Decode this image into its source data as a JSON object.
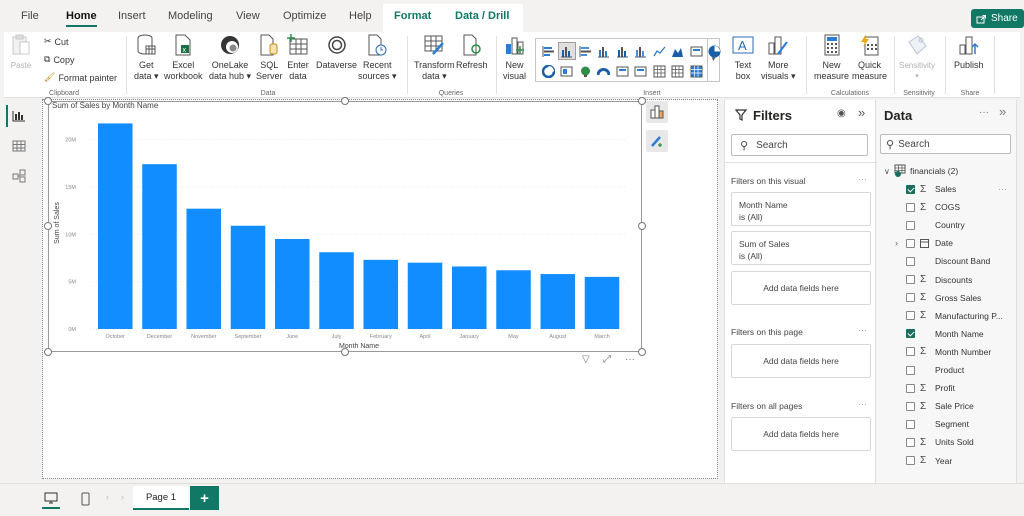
{
  "tabs": [
    "File",
    "Home",
    "Insert",
    "Modeling",
    "View",
    "Optimize",
    "Help",
    "Format",
    "Data / Drill"
  ],
  "active_tab": "Home",
  "share_label": "Share",
  "ribbon": {
    "clipboard": {
      "paste": "Paste",
      "cut": "Cut",
      "copy": "Copy",
      "format_painter": "Format painter",
      "group": "Clipboard"
    },
    "data": {
      "get_data": [
        "Get",
        "data ▾"
      ],
      "excel": [
        "Excel",
        "workbook"
      ],
      "onelake": [
        "OneLake",
        "data hub ▾"
      ],
      "sql": [
        "SQL",
        "Server"
      ],
      "enter": [
        "Enter",
        "data"
      ],
      "dataverse": [
        "Dataverse",
        ""
      ],
      "recent": [
        "Recent",
        "sources ▾"
      ],
      "group": "Data"
    },
    "queries": {
      "transform": [
        "Transform",
        "data ▾"
      ],
      "refresh": [
        "Refresh",
        ""
      ],
      "group": "Queries"
    },
    "insert": {
      "new_visual": [
        "New",
        "visual"
      ],
      "text_box": [
        "Text",
        "box"
      ],
      "more_visuals": [
        "More",
        "visuals ▾"
      ],
      "group": "Insert",
      "gallery": [
        "stacked-bar",
        "clustered-column",
        "clustered-bar",
        "stacked-column",
        "100-column",
        "line-column",
        "line",
        "area",
        "scatter",
        "pie",
        "donut",
        "treemap",
        "map",
        "gauge",
        "card",
        "multi-row-card",
        "table",
        "matrix",
        "kpi-grid"
      ]
    },
    "calculations": {
      "new_measure": [
        "New",
        "measure"
      ],
      "quick_measure": [
        "Quick",
        "measure"
      ],
      "group": "Calculations"
    },
    "sensitivity": {
      "label": [
        "Sensitivity",
        "▾"
      ],
      "group": "Sensitivity"
    },
    "share": {
      "publish": [
        "Publish",
        ""
      ],
      "group": "Share"
    }
  },
  "visual": {
    "title": "Sum of Sales by Month Name"
  },
  "chart_data": {
    "type": "bar",
    "title": "Sum of Sales by Month Name",
    "xlabel": "Month Name",
    "ylabel": "Sum of Sales",
    "categories": [
      "October",
      "December",
      "November",
      "September",
      "June",
      "July",
      "February",
      "April",
      "January",
      "May",
      "August",
      "March"
    ],
    "values": [
      21.7,
      17.4,
      12.7,
      10.9,
      9.5,
      8.1,
      7.3,
      7.0,
      6.6,
      6.2,
      5.8,
      5.5
    ],
    "value_unit": "M",
    "yticks": [
      "0M",
      "5M",
      "10M",
      "15M",
      "20M"
    ],
    "ylim": [
      0,
      22.8
    ],
    "grid": true,
    "color": "#118DFF"
  },
  "filters": {
    "title": "Filters",
    "search_placeholder": "Search",
    "on_visual": "Filters on this visual",
    "cards": [
      {
        "field": "Month Name",
        "state": "is (All)"
      },
      {
        "field": "Sum of Sales",
        "state": "is (All)"
      }
    ],
    "add_fields": "Add data fields here",
    "on_page": "Filters on this page",
    "on_all_pages": "Filters on all pages"
  },
  "data_pane": {
    "title": "Data",
    "search_placeholder": "Search",
    "table_name": "financials (2)",
    "fields": [
      {
        "name": "Sales",
        "sigma": true,
        "checked": true
      },
      {
        "name": "COGS",
        "sigma": true,
        "checked": false
      },
      {
        "name": "Country",
        "sigma": false,
        "checked": false
      },
      {
        "name": "Date",
        "sigma": false,
        "checked": false,
        "expandable": true
      },
      {
        "name": "Discount Band",
        "sigma": false,
        "checked": false
      },
      {
        "name": "Discounts",
        "sigma": true,
        "checked": false
      },
      {
        "name": "Gross Sales",
        "sigma": true,
        "checked": false
      },
      {
        "name": "Manufacturing P...",
        "sigma": true,
        "checked": false
      },
      {
        "name": "Month Name",
        "sigma": false,
        "checked": true
      },
      {
        "name": "Month Number",
        "sigma": true,
        "checked": false
      },
      {
        "name": "Product",
        "sigma": false,
        "checked": false
      },
      {
        "name": "Profit",
        "sigma": true,
        "checked": false
      },
      {
        "name": "Sale Price",
        "sigma": true,
        "checked": false
      },
      {
        "name": "Segment",
        "sigma": false,
        "checked": false
      },
      {
        "name": "Units Sold",
        "sigma": true,
        "checked": false
      },
      {
        "name": "Year",
        "sigma": true,
        "checked": false
      }
    ]
  },
  "pages": [
    {
      "label": "Page 1",
      "active": true
    }
  ],
  "add_page_label": "+",
  "colors": {
    "accent": "#117865",
    "bar": "#118DFF"
  }
}
